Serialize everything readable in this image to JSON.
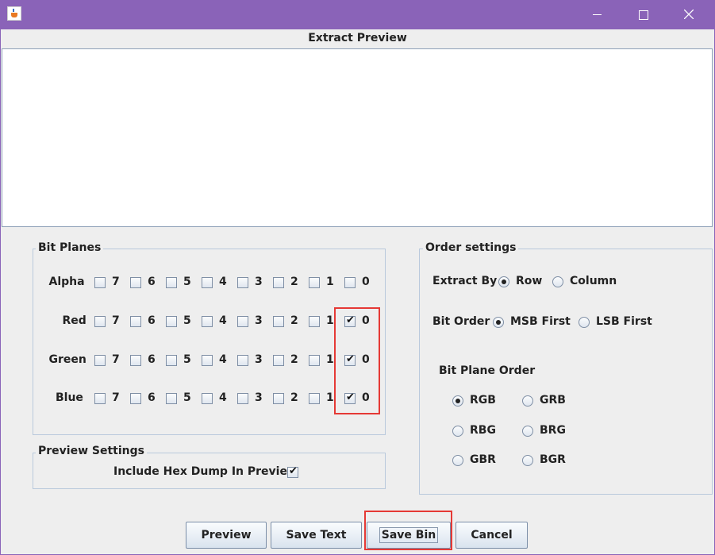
{
  "window": {
    "title": ""
  },
  "preview": {
    "title": "Extract Preview",
    "content": ""
  },
  "bit_planes": {
    "title": "Bit Planes",
    "bits": [
      "7",
      "6",
      "5",
      "4",
      "3",
      "2",
      "1",
      "0"
    ],
    "channels": [
      {
        "name": "Alpha",
        "checked": []
      },
      {
        "name": "Red",
        "checked": [
          "0"
        ]
      },
      {
        "name": "Green",
        "checked": [
          "0"
        ]
      },
      {
        "name": "Blue",
        "checked": [
          "0"
        ]
      }
    ]
  },
  "preview_settings": {
    "title": "Preview Settings",
    "hex_dump_label": "Include Hex Dump In Preview",
    "hex_dump_checked": true
  },
  "order": {
    "title": "Order settings",
    "extract_by": {
      "label": "Extract By",
      "options": [
        "Row",
        "Column"
      ],
      "selected": "Row"
    },
    "bit_order": {
      "label": "Bit Order",
      "options": [
        "MSB First",
        "LSB First"
      ],
      "selected": "MSB First"
    },
    "plane_order": {
      "label": "Bit Plane Order",
      "options": [
        "RGB",
        "GRB",
        "RBG",
        "BRG",
        "GBR",
        "BGR"
      ],
      "selected": "RGB"
    }
  },
  "buttons": {
    "preview": "Preview",
    "save_text": "Save Text",
    "save_bin": "Save Bin",
    "cancel": "Cancel"
  },
  "colors": {
    "title_bar": "#8a63b8",
    "highlight": "#e53935"
  }
}
